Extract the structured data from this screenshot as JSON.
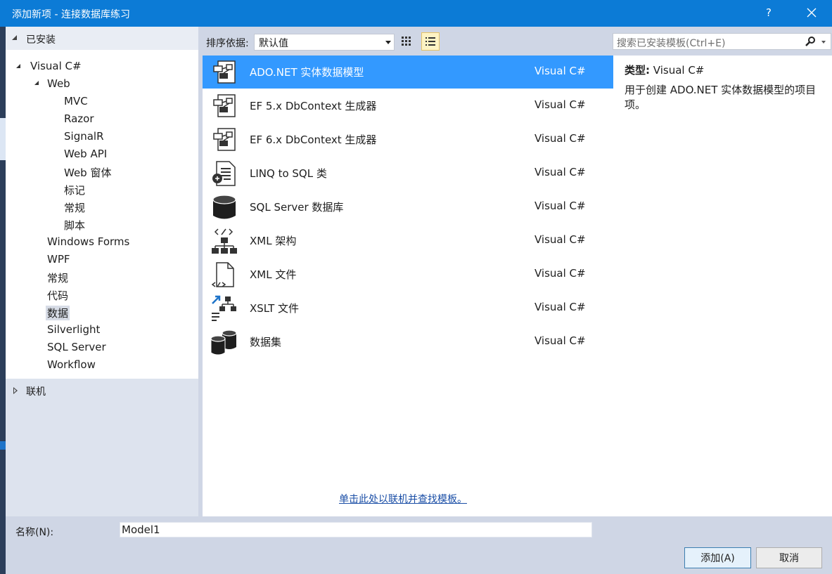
{
  "window": {
    "title": "添加新项 - 连接数据库练习",
    "help": "?",
    "close": "✕"
  },
  "left": {
    "installed": "已安装",
    "tree": [
      {
        "label": "Visual C#",
        "level": 0,
        "expanded": true
      },
      {
        "label": "Web",
        "level": 1,
        "expanded": true
      },
      {
        "label": "MVC",
        "level": 2
      },
      {
        "label": "Razor",
        "level": 2
      },
      {
        "label": "SignalR",
        "level": 2
      },
      {
        "label": "Web API",
        "level": 2
      },
      {
        "label": "Web 窗体",
        "level": 2
      },
      {
        "label": "标记",
        "level": 2
      },
      {
        "label": "常规",
        "level": 2
      },
      {
        "label": "脚本",
        "level": 2
      },
      {
        "label": "Windows Forms",
        "level": 1
      },
      {
        "label": "WPF",
        "level": 1
      },
      {
        "label": "常规",
        "level": 1
      },
      {
        "label": "代码",
        "level": 1
      },
      {
        "label": "数据",
        "level": 1,
        "selected": true
      },
      {
        "label": "Silverlight",
        "level": 1
      },
      {
        "label": "SQL Server",
        "level": 1
      },
      {
        "label": "Workflow",
        "level": 1
      }
    ],
    "online": "联机"
  },
  "toolbar": {
    "sort_label": "排序依据:",
    "sort_value": "默认值",
    "search_placeholder": "搜索已安装模板(Ctrl+E)"
  },
  "templates": [
    {
      "name": "ADO.NET 实体数据模型",
      "lang": "Visual C#",
      "icon": "entity-model-icon",
      "selected": true
    },
    {
      "name": "EF 5.x DbContext 生成器",
      "lang": "Visual C#",
      "icon": "dbcontext-generator-icon"
    },
    {
      "name": "EF 6.x DbContext 生成器",
      "lang": "Visual C#",
      "icon": "dbcontext-generator-icon"
    },
    {
      "name": "LINQ to SQL 类",
      "lang": "Visual C#",
      "icon": "linq-to-sql-icon"
    },
    {
      "name": "SQL Server 数据库",
      "lang": "Visual C#",
      "icon": "database-icon"
    },
    {
      "name": "XML 架构",
      "lang": "Visual C#",
      "icon": "xml-schema-icon"
    },
    {
      "name": "XML 文件",
      "lang": "Visual C#",
      "icon": "xml-file-icon"
    },
    {
      "name": "XSLT 文件",
      "lang": "Visual C#",
      "icon": "xslt-file-icon"
    },
    {
      "name": "数据集",
      "lang": "Visual C#",
      "icon": "dataset-icon"
    }
  ],
  "online_link": "单击此处以联机并查找模板。",
  "info": {
    "type_label": "类型:",
    "type_value": "Visual C#",
    "description": "用于创建 ADO.NET 实体数据模型的项目项。"
  },
  "bottom": {
    "name_label": "名称(N):",
    "name_value": "Model1",
    "add": "添加(A)",
    "cancel": "取消"
  },
  "colors": {
    "titlebar": "#0c7bd6",
    "selection": "#3399ff",
    "link": "#1a4ea6"
  }
}
